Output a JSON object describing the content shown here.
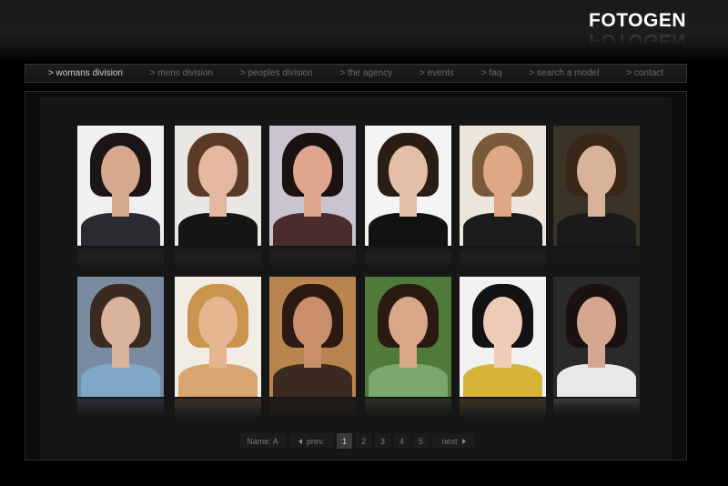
{
  "brand": {
    "logo": "FOTOGEN"
  },
  "nav": {
    "items": [
      {
        "label": "> womans division",
        "active": true
      },
      {
        "label": "> mens division"
      },
      {
        "label": "> peoples division"
      },
      {
        "label": "> the agency"
      },
      {
        "label": "> events"
      },
      {
        "label": "> faq"
      },
      {
        "label": "> search a model"
      },
      {
        "label": "> contact"
      }
    ]
  },
  "gallery": {
    "models": [
      {
        "bg": "#f0f0f0",
        "skin": "#d6a98c",
        "hair": "#1c1515",
        "top": "#2b2b30"
      },
      {
        "bg": "#e9e7e3",
        "skin": "#e4b7a0",
        "hair": "#5b3a28",
        "top": "#151515"
      },
      {
        "bg": "#c9c4cf",
        "skin": "#e0a68d",
        "hair": "#1b1111",
        "top": "#4a2c2c"
      },
      {
        "bg": "#f4f4f4",
        "skin": "#e3bfa8",
        "hair": "#2b1d15",
        "top": "#121212"
      },
      {
        "bg": "#ece6dc",
        "skin": "#dfa785",
        "hair": "#7a5a3a",
        "top": "#1c1c1c"
      },
      {
        "bg": "#3a3428",
        "skin": "#d8b39a",
        "hair": "#3a2618",
        "top": "#1a1a1a"
      },
      {
        "bg": "#7a8aa0",
        "skin": "#d9b39c",
        "hair": "#3a2a20",
        "top": "#7fa8c8"
      },
      {
        "bg": "#f2ede4",
        "skin": "#e4b58e",
        "hair": "#c8944e",
        "top": "#d9a570"
      },
      {
        "bg": "#b9844e",
        "skin": "#c98f6d",
        "hair": "#2a1a12",
        "top": "#3a2a20"
      },
      {
        "bg": "#4f7a3a",
        "skin": "#d9a888",
        "hair": "#2a1a12",
        "top": "#7aa86a"
      },
      {
        "bg": "#f1f1f1",
        "skin": "#efcbb8",
        "hair": "#121212",
        "top": "#d8b33a"
      },
      {
        "bg": "#2a2a2a",
        "skin": "#d5a790",
        "hair": "#1a1210",
        "top": "#e8e8e8"
      }
    ]
  },
  "pager": {
    "name_filter": "Name: A",
    "prev_label": "prev.",
    "pages": [
      "1",
      "2",
      "3",
      "4",
      "5"
    ],
    "current": "1",
    "next_label": "next"
  }
}
